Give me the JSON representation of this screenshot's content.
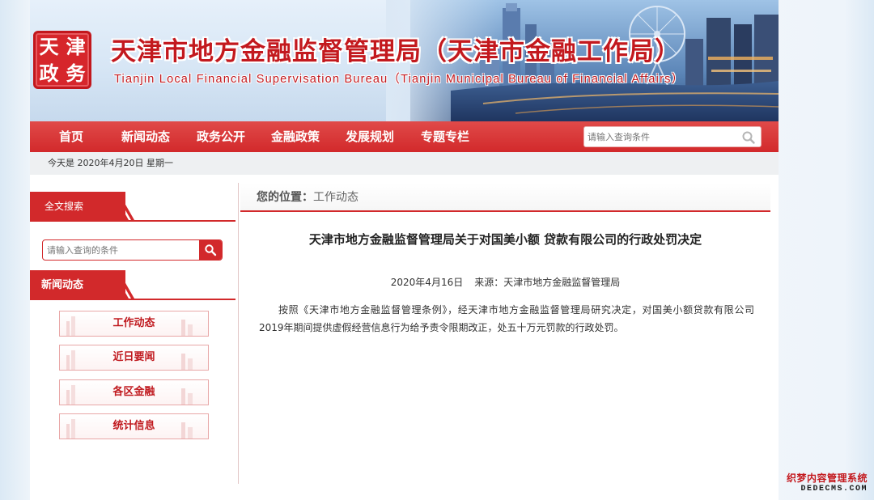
{
  "header": {
    "seal_chars": [
      "天",
      "津",
      "政",
      "务"
    ],
    "title": "天津市地方金融监督管理局（天津市金融工作局）",
    "subtitle": "Tianjin Local Financial Supervisation Bureau（Tianjin Municipal Bureau of Financial Affairs）"
  },
  "nav": {
    "items": [
      "首页",
      "新闻动态",
      "政务公开",
      "金融政策",
      "发展规划",
      "专题专栏"
    ],
    "search_placeholder": "请输入查询条件"
  },
  "date_bar": {
    "text": "今天是 2020年4月20日 星期一"
  },
  "sidebar": {
    "search_section_title": "全文搜索",
    "search_placeholder": "请输入查询的条件",
    "news_section_title": "新闻动态",
    "links": [
      "工作动态",
      "近日要闻",
      "各区金融",
      "统计信息"
    ]
  },
  "main": {
    "breadcrumb_label": "您的位置：",
    "breadcrumb_current": "工作动态",
    "article": {
      "title": "天津市地方金融监督管理局关于对国美小额 贷款有限公司的行政处罚决定",
      "date": "2020年4月16日",
      "source": "来源：天津市地方金融监督管理局",
      "body": "按照《天津市地方金融监督管理条例》，经天津市地方金融监督管理局研究决定，对国美小额贷款有限公司2019年期间提供虚假经营信息行为给予责令限期改正，处五十万元罚款的行政处罚。"
    }
  },
  "watermark": {
    "line1": "织梦内容管理系统",
    "line2": "DEDECMS.COM"
  },
  "colors": {
    "brand_red": "#d2292b",
    "title_red": "#c3191e",
    "datebar_bg": "#eef0f2"
  }
}
